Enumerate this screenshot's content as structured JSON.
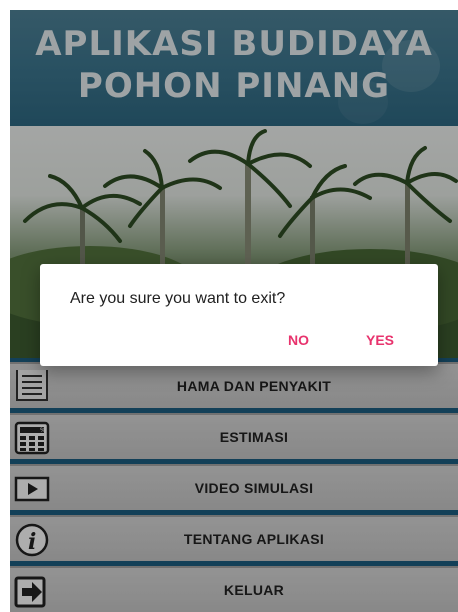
{
  "header": {
    "title_line1": "APLIKASI BUDIDAYA",
    "title_line2": "POHON PINANG"
  },
  "menu": {
    "items": [
      {
        "label": "HAMA DAN PENYAKIT",
        "icon": "document-list-icon"
      },
      {
        "label": "ESTIMASI",
        "icon": "calculator-icon"
      },
      {
        "label": "VIDEO SIMULASI",
        "icon": "play-icon"
      },
      {
        "label": "TENTANG APLIKASI",
        "icon": "info-icon"
      },
      {
        "label": "KELUAR",
        "icon": "exit-icon"
      }
    ]
  },
  "dialog": {
    "message": "Are you sure you want to exit?",
    "no_label": "NO",
    "yes_label": "YES"
  },
  "colors": {
    "header": "#3d7891",
    "menu_background": "#1c5f82",
    "dialog_button": "#e8336d"
  }
}
